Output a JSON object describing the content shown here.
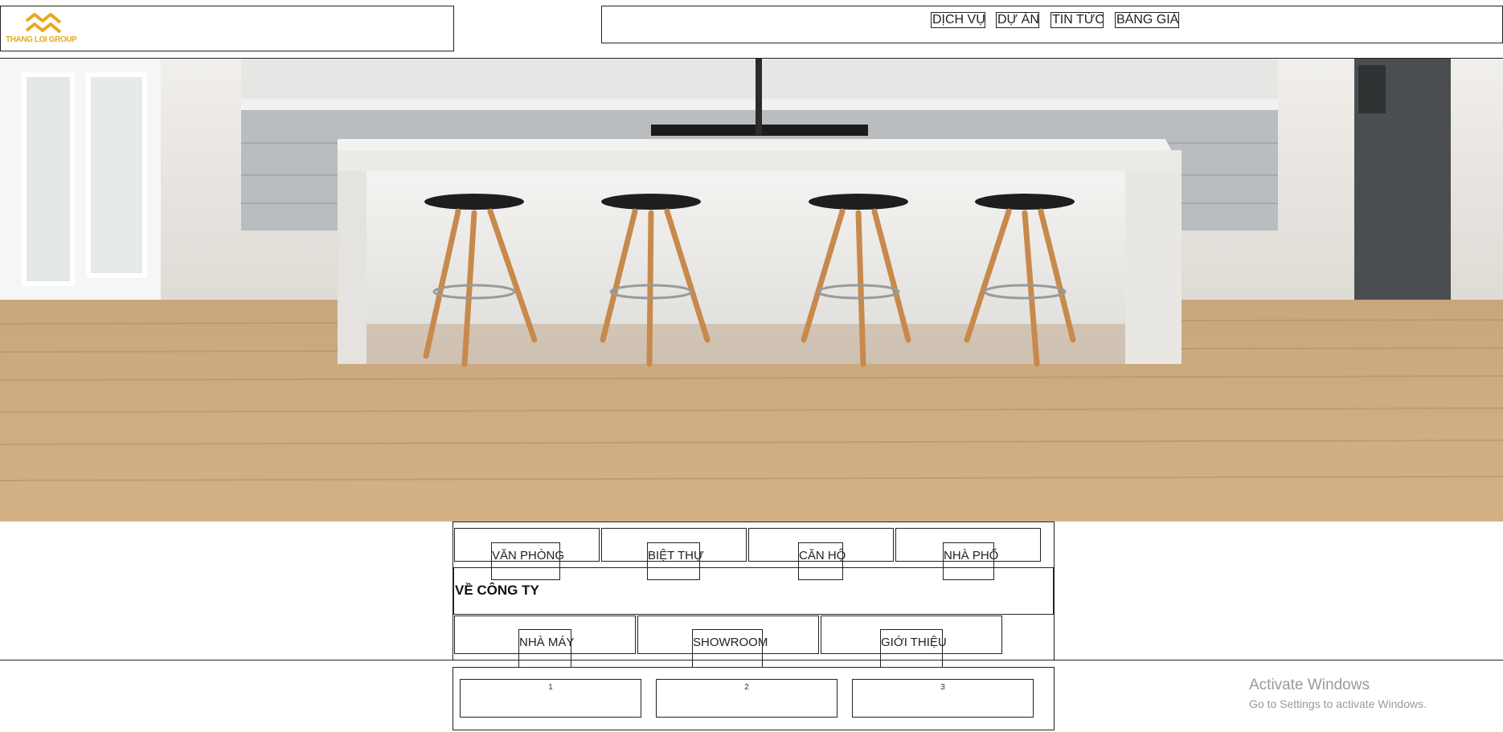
{
  "header": {
    "logo_text": "THANG LOI GROUP",
    "brand_color": "#e7a91e",
    "nav": [
      "DỊCH VỤ",
      "DỰ ÁN",
      "TIN TỨC",
      "BẢNG GIÁ"
    ]
  },
  "hero": {
    "alt": "kitchen-island-photo"
  },
  "categories": [
    "VĂN PHÒNG",
    "BIỆT THỰ",
    "CĂN HỘ",
    "NHÀ PHỐ"
  ],
  "about": {
    "title": "VỀ CÔNG TY",
    "items": [
      "NHÀ MÁY",
      "SHOWROOM",
      "GIỚI THIỆU"
    ]
  },
  "slider": {
    "slides": [
      "1",
      "2",
      "3"
    ]
  },
  "watermark": {
    "title": "Activate Windows",
    "subtitle": "Go to Settings to activate Windows."
  }
}
